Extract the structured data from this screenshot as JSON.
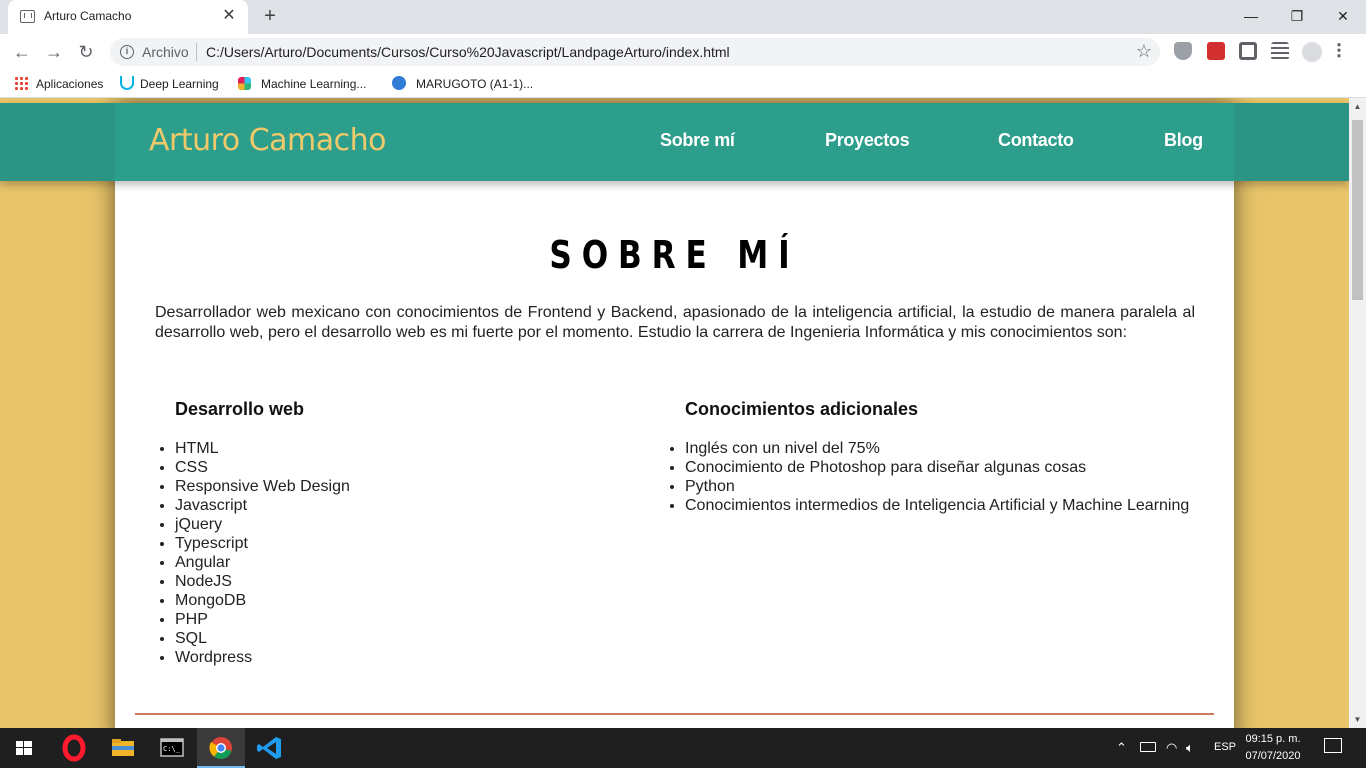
{
  "browser": {
    "tab_title": "Arturo Camacho",
    "tab_close": "✕",
    "new_tab": "+",
    "window": {
      "minimize": "—",
      "restore": "❐",
      "close": "✕"
    },
    "nav": {
      "back": "←",
      "forward": "→",
      "reload": "↻"
    },
    "scheme_label": "Archivo",
    "url": "C:/Users/Arturo/Documents/Cursos/Curso%20Javascript/LandpageArturo/index.html",
    "star": "☆",
    "bookmarks": [
      {
        "label": "Aplicaciones",
        "icon": "apps-grid-icon"
      },
      {
        "label": "Deep Learning",
        "icon": "udacity-icon"
      },
      {
        "label": "Machine Learning...",
        "icon": "slack-icon"
      },
      {
        "label": "MARUGOTO (A1-1)...",
        "icon": "edge-icon"
      }
    ]
  },
  "site": {
    "brand": "Arturo Camacho",
    "nav": [
      "Sobre mí",
      "Proyectos",
      "Contacto",
      "Blog"
    ],
    "section_title": "SOBRE MÍ",
    "intro": "Desarrollador web mexicano con conocimientos de Frontend y Backend, apasionado de la inteligencia artificial, la estudio de manera paralela al desarrollo web, pero el desarrollo web es mi fuerte por el momento. Estudio la carrera de Ingenieria Informática y mis conocimientos son:",
    "columns": [
      {
        "title": "Desarrollo web",
        "items": [
          "HTML",
          "CSS",
          "Responsive Web Design",
          "Javascript",
          "jQuery",
          "Typescript",
          "Angular",
          "NodeJS",
          "MongoDB",
          "PHP",
          "SQL",
          "Wordpress"
        ]
      },
      {
        "title": "Conocimientos adicionales",
        "items": [
          "Inglés con un nivel del 75%",
          "Conocimiento de Photoshop para diseñar algunas cosas",
          "Python",
          "Conocimientos intermedios de Inteligencia Artificial y Machine Learning"
        ]
      }
    ],
    "colors": {
      "header": "#2e9e8c",
      "brand": "#efc96a",
      "background": "#e8c46a",
      "divider": "#c97b5e"
    }
  },
  "taskbar": {
    "language": "ESP",
    "time": "09:15 p. m.",
    "date": "07/07/2020",
    "apps": [
      "windows-start-icon",
      "opera-icon",
      "file-explorer-icon",
      "terminal-icon",
      "chrome-icon",
      "vscode-icon"
    ]
  }
}
